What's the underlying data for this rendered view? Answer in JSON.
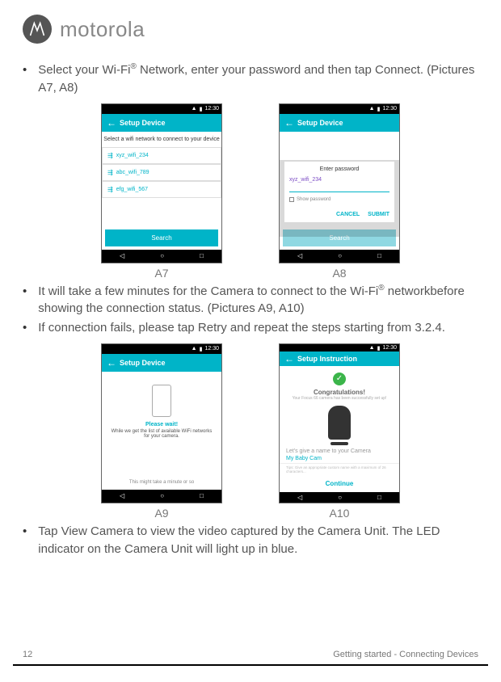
{
  "brand": {
    "name": "motorola"
  },
  "bullets": {
    "b1a": "Select your Wi-Fi",
    "b1b": " Network, enter your password and then tap Connect. (Pictures A7, A8)",
    "b2a": "It will take a few minutes for the Camera to connect to the Wi-Fi",
    "b2b": " networkbefore showing the connection status. (Pictures A9, A10)",
    "b3": "If connection fails, please tap Retry and repeat the steps starting from 3.2.4.",
    "b4": "Tap View Camera to view the video captured by the Camera Unit. The LED indicator on the Camera Unit will light up in blue."
  },
  "captions": {
    "a7": "A7",
    "a8": "A8",
    "a9": "A9",
    "a10": "A10"
  },
  "phones": {
    "status_time": "12:30",
    "title_setup": "Setup Device",
    "title_instruction": "Setup Instruction",
    "a7": {
      "prompt": "Select a wifi network to connect to your device",
      "items": [
        "xyz_wifi_234",
        "abc_wifi_789",
        "efg_wifi_567"
      ],
      "search": "Search"
    },
    "a8": {
      "dialog_title": "Enter password",
      "network": "xyz_wifi_234",
      "show_password": "Show password",
      "cancel": "CANCEL",
      "submit": "SUBMIT",
      "search": "Search"
    },
    "a9": {
      "title": "Please wait!",
      "sub": "While we get the list of available WiFi networks for your camera.",
      "foot": "This might take a minute or so"
    },
    "a10": {
      "congrats": "Congratulations!",
      "sub": "Your Focus 66 camera has been successfully set up!",
      "name_label": "Let's give a name to your Camera",
      "name_value": "My Baby Cam",
      "hint": "Tips: Give an appropriate custom name with a maximum of 26 characters...",
      "continue": "Continue"
    }
  },
  "footer": {
    "page": "12",
    "section": "Getting started - Connecting Devices"
  },
  "reg": "®"
}
